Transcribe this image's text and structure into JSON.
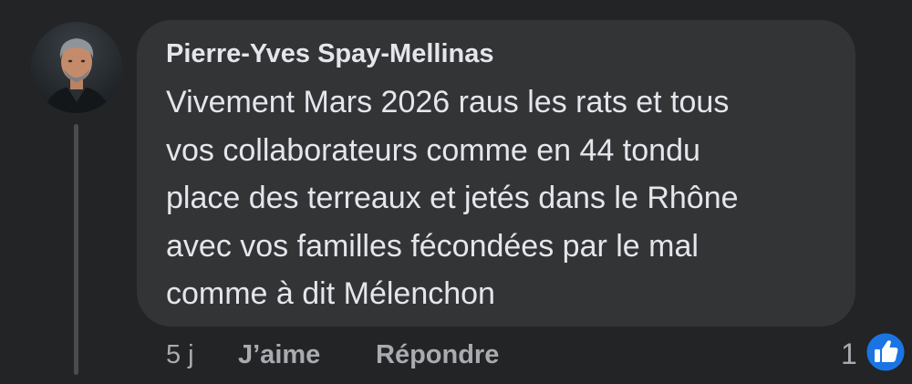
{
  "comment": {
    "author": "Pierre-Yves Spay-Mellinas",
    "lines": [
      "Vivement Mars 2026 raus les rats et tous",
      "vos collaborateurs comme en 44 tondu",
      "place des terreaux et jetés dans le Rhône",
      "avec vos familles fécondées par le mal",
      "comme à dit Mélenchon"
    ]
  },
  "meta": {
    "time": "5 j",
    "like_label": "J’aime",
    "reply_label": "Répondre",
    "reaction_count": "1"
  },
  "icons": {
    "reaction": "like-thumbs-up-icon"
  },
  "colors": {
    "background": "#232425",
    "bubble": "#333436",
    "primary_text": "#e4e6eb",
    "secondary_text": "#a8abaf",
    "like_blue": "#1b74e4"
  }
}
